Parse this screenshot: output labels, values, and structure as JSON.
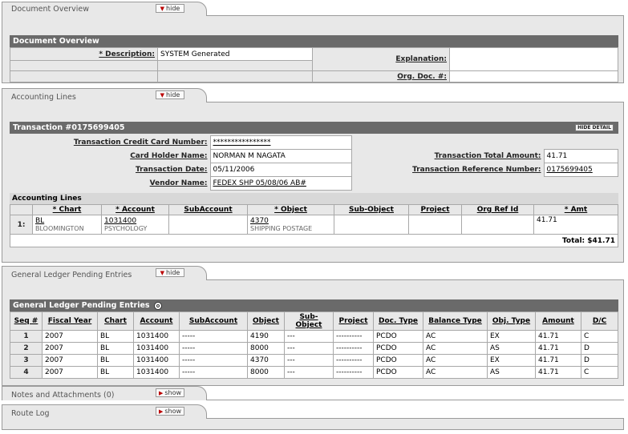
{
  "doc_overview": {
    "tab_label": "Document Overview",
    "hide_label": "hide",
    "header": "Document Overview",
    "description_label": "* Description:",
    "description_value": "SYSTEM Generated",
    "explanation_label": "Explanation:",
    "explanation_value": "",
    "org_doc_label": "Org. Doc. #:",
    "org_doc_value": ""
  },
  "accounting": {
    "tab_label": "Accounting Lines",
    "hide_label": "hide",
    "transaction_header": "Transaction #0175699405",
    "hide_detail_label": "HIDE DETAIL",
    "card_number_label": "Transaction Credit Card Number:",
    "card_number_value": "****************",
    "card_holder_label": "Card Holder Name:",
    "card_holder_value": "NORMAN M NAGATA",
    "total_amount_label": "Transaction Total Amount:",
    "total_amount_value": "41.71",
    "date_label": "Transaction Date:",
    "date_value": "05/11/2006",
    "ref_number_label": "Transaction Reference Number:",
    "ref_number_value": "0175699405",
    "vendor_label": "Vendor Name:",
    "vendor_value": "FEDEX SHP 05/08/06 AB#",
    "lines_header": "Accounting Lines",
    "columns": [
      "* Chart",
      "* Account",
      "SubAccount",
      "* Object",
      "Sub-Object",
      "Project",
      "Org Ref Id",
      "* Amt"
    ],
    "line": {
      "seq": "1:",
      "chart": "BL",
      "chart_desc": "BLOOMINGTON",
      "account": "1031400",
      "account_desc": "PSYCHOLOGY",
      "object": "4370",
      "object_desc": "SHIPPING POSTAGE",
      "amount": "41.71"
    },
    "total_label": "Total: $41.71"
  },
  "glpe": {
    "tab_label": "General Ledger Pending Entries",
    "hide_label": "hide",
    "header": "General Ledger Pending Entries",
    "columns": [
      "Seq #",
      "Fiscal Year",
      "Chart",
      "Account",
      "SubAccount",
      "Object",
      "Sub-Object",
      "Project",
      "Doc. Type",
      "Balance Type",
      "Obj. Type",
      "Amount",
      "D/C"
    ],
    "rows": [
      [
        "1",
        "2007",
        "BL",
        "1031400",
        "-----",
        "4190",
        "---",
        "----------",
        "PCDO",
        "AC",
        "EX",
        "41.71",
        "C"
      ],
      [
        "2",
        "2007",
        "BL",
        "1031400",
        "-----",
        "8000",
        "---",
        "----------",
        "PCDO",
        "AC",
        "AS",
        "41.71",
        "D"
      ],
      [
        "3",
        "2007",
        "BL",
        "1031400",
        "-----",
        "4370",
        "---",
        "----------",
        "PCDO",
        "AC",
        "EX",
        "41.71",
        "D"
      ],
      [
        "4",
        "2007",
        "BL",
        "1031400",
        "-----",
        "8000",
        "---",
        "----------",
        "PCDO",
        "AC",
        "AS",
        "41.71",
        "C"
      ]
    ]
  },
  "notes": {
    "tab_label": "Notes and Attachments (0)",
    "show_label": "show"
  },
  "route": {
    "tab_label": "Route Log",
    "show_label": "show"
  }
}
